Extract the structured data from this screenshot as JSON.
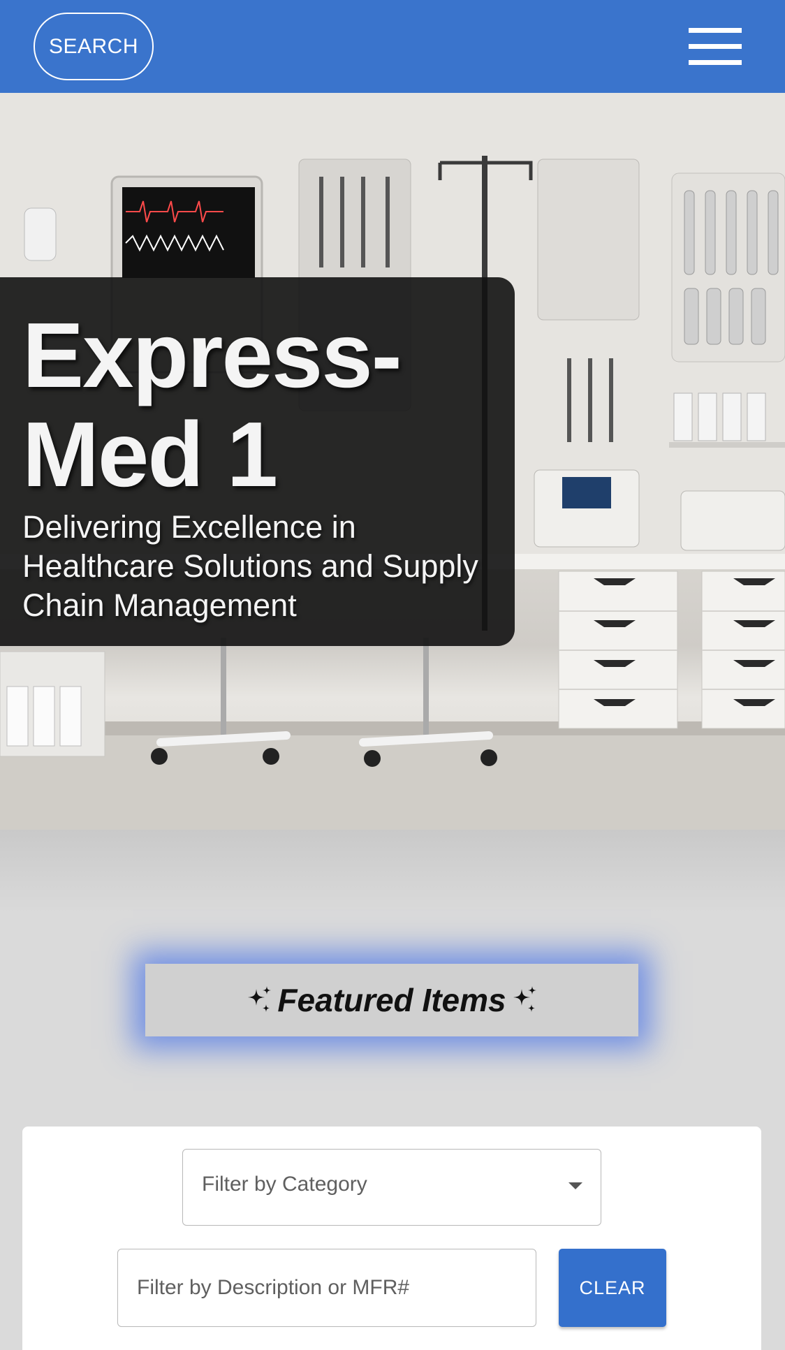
{
  "header": {
    "search_label": "SEARCH",
    "menu_icon": "hamburger-menu-icon",
    "background_color": "#3a74cc"
  },
  "hero": {
    "title": "Express-Med 1",
    "subtitle": "Delivering Excellence in Healthcare Solutions and Supply Chain Management"
  },
  "featured": {
    "label": "Featured Items",
    "icon": "sparkles-icon",
    "glow_color": "#5078e6"
  },
  "filters": {
    "category_placeholder": "Filter by Category",
    "description_placeholder": "Filter by Description or MFR#",
    "clear_label": "CLEAR",
    "accent_color": "#3470cc"
  }
}
